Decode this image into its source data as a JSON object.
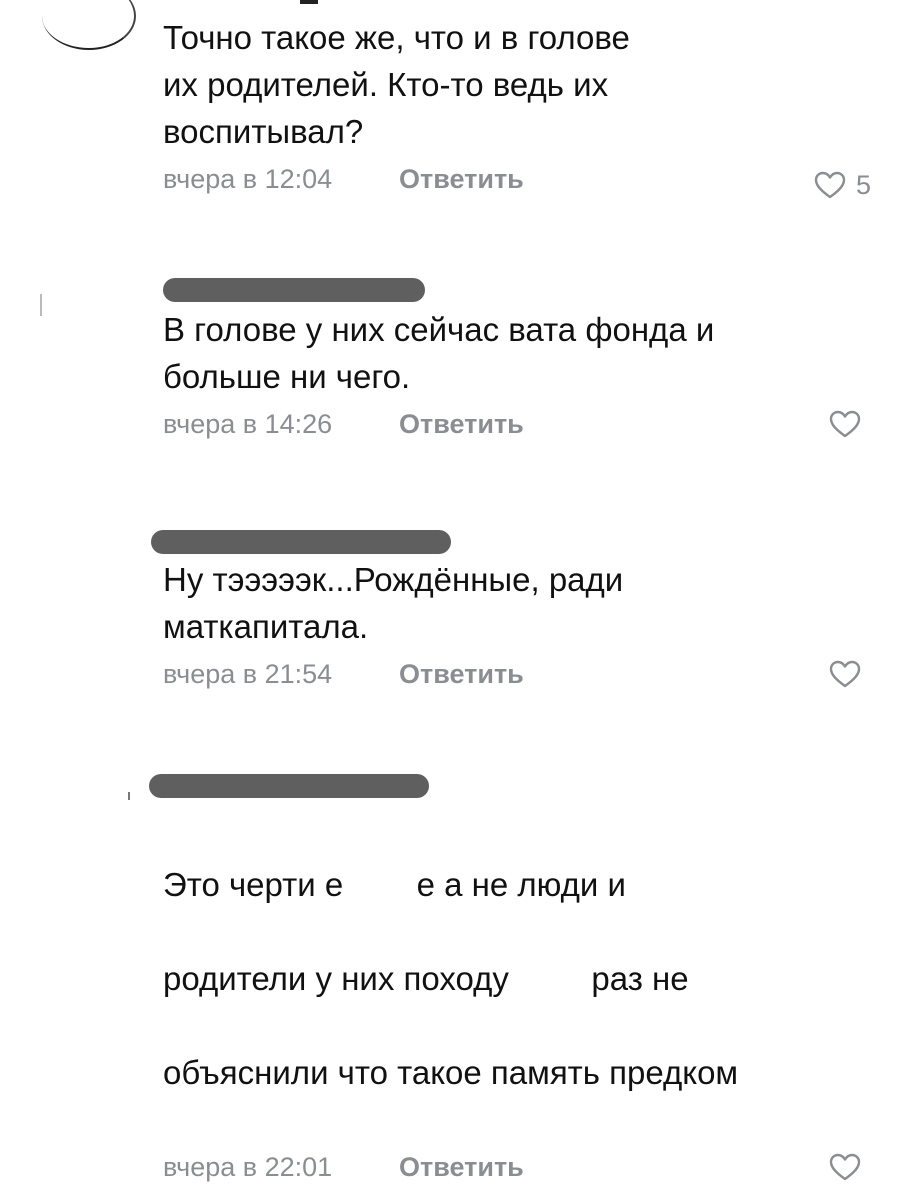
{
  "comments": [
    {
      "author": "",
      "text": "Точно такое же, что и в голове\nих родителей. Кто-то ведь их\nвоспитывал?",
      "time": "вчера в 12:04",
      "reply_label": "Ответить",
      "likes": "5"
    },
    {
      "author": "",
      "text": "В голове у них сейчас вата фонда и\nбольше ни чего.",
      "time": "вчера в 14:26",
      "reply_label": "Ответить",
      "likes": ""
    },
    {
      "author": "",
      "text": "Ну тэээээк...Рождённые, ради\nматкапитала.",
      "time": "вчера в 21:54",
      "reply_label": "Ответить",
      "likes": ""
    },
    {
      "author": "",
      "text_line1_a": "Это черти е",
      "text_line1_b": "е а не люди и",
      "text_line2_a": "родители у них походу ",
      "text_line2_b": "раз не",
      "text_line3": "объяснили что такое память предком",
      "time": "вчера в 22:01",
      "reply_label": "Ответить",
      "likes": ""
    }
  ],
  "icons": {
    "like": "heart-outline-icon",
    "avatar": "avatar"
  },
  "colors": {
    "text": "#111111",
    "meta": "#8a8d91",
    "redaction": "#5f5f5f"
  }
}
